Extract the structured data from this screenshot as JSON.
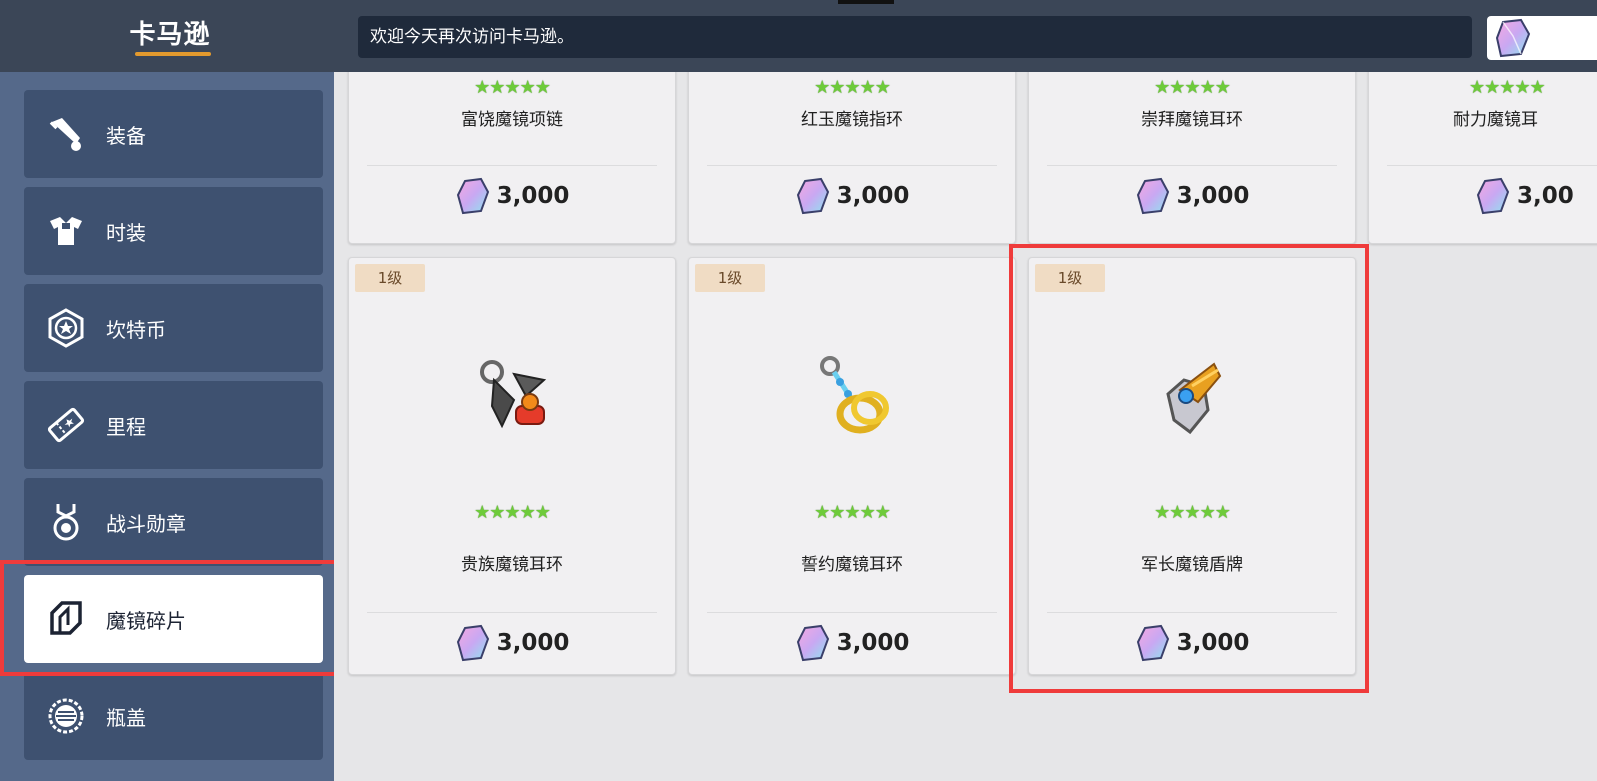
{
  "app": {
    "title": "卡马逊"
  },
  "header": {
    "welcome_text": "欢迎今天再次访问卡马逊。"
  },
  "sidebar": {
    "items": [
      {
        "label": "装备",
        "icon": "equipment-icon"
      },
      {
        "label": "时装",
        "icon": "outfit-icon"
      },
      {
        "label": "坎特币",
        "icon": "coin-icon"
      },
      {
        "label": "里程",
        "icon": "ticket-icon"
      },
      {
        "label": "战斗勋章",
        "icon": "medal-icon"
      },
      {
        "label": "魔镜碎片",
        "icon": "shard-icon",
        "active": true
      },
      {
        "label": "瓶盖",
        "icon": "bottle-cap-icon"
      }
    ]
  },
  "products": {
    "row1": [
      {
        "name": "富饶魔镜项链",
        "price": "3,000",
        "stars": "★★★★★"
      },
      {
        "name": "红玉魔镜指环",
        "price": "3,000",
        "stars": "★★★★★"
      },
      {
        "name": "崇拜魔镜耳环",
        "price": "3,000",
        "stars": "★★★★★"
      },
      {
        "name": "耐力魔镜耳",
        "price": "3,00",
        "stars": "★★★★★"
      }
    ],
    "row2": [
      {
        "level": "1级",
        "name": "贵族魔镜耳环",
        "price": "3,000",
        "stars": "★★★★★",
        "icon": "earring-icon"
      },
      {
        "level": "1级",
        "name": "誓约魔镜耳环",
        "price": "3,000",
        "stars": "★★★★★",
        "icon": "ring-earring-icon"
      },
      {
        "level": "1级",
        "name": "军长魔镜盾牌",
        "price": "3,000",
        "stars": "★★★★★",
        "icon": "shield-icon"
      }
    ]
  },
  "colors": {
    "accent": "#e39a2e",
    "highlight": "#ef3b3b",
    "star": "#6ecb3a",
    "sidebar": "#55698a",
    "topbar": "#3b4657"
  },
  "currency_icon": "diamond-gem-icon"
}
